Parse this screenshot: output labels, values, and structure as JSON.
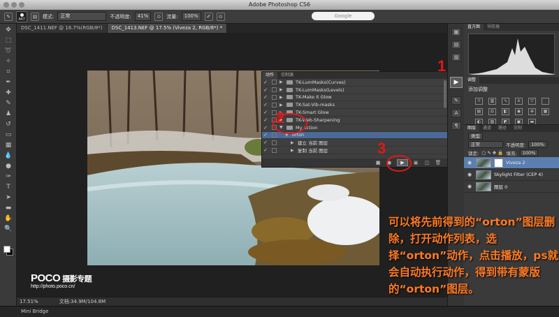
{
  "window": {
    "title": "Adobe Photoshop CS6",
    "watermark_top": "思缘设计论坛  PS教程论坛\nBBS.16XX8.COM"
  },
  "options_bar": {
    "brush_size": "447",
    "mode_label": "模式:",
    "mode_value": "正常",
    "opacity_label": "不透明度:",
    "opacity_value": "41%",
    "flow_label": "流量:",
    "flow_value": "100%",
    "search_placeholder": "Google",
    "workspace_watermark": "思缘设计论坛 PS教程论坛"
  },
  "doc_tabs": [
    {
      "label": "DSC_1411.NEF @ 16.7%(RGB/8*)"
    },
    {
      "label": "DSC_1413.NEF @ 17.5% (Viveza 2, RGB/8*) *"
    }
  ],
  "actions_panel": {
    "tabs": [
      "动作",
      "仿制源"
    ],
    "rows": [
      {
        "label": "TK-LumMasks(Curves)",
        "type": "set"
      },
      {
        "label": "TK-LumMasks(Levels)",
        "type": "set"
      },
      {
        "label": "TK-Make It Glow",
        "type": "set"
      },
      {
        "label": "TK-Sat-Vib-masks",
        "type": "set"
      },
      {
        "label": "TK-Smart Glow",
        "type": "set"
      },
      {
        "label": "TK-Web-Sharpening",
        "type": "set"
      },
      {
        "label": "My action",
        "type": "set"
      },
      {
        "label": "orton",
        "type": "action"
      },
      {
        "label": "建立 当前 图层",
        "type": "step"
      },
      {
        "label": "复制 当前 图层",
        "type": "step"
      }
    ]
  },
  "markers": [
    "1",
    "2",
    "3"
  ],
  "right_panel": {
    "histogram_tabs": [
      "直方图",
      "导航器"
    ],
    "adjust_tabs": [
      "调整"
    ],
    "adjust_title": "添加调整",
    "layers_tabs": [
      "图层",
      "通道",
      "路径",
      "仿制"
    ],
    "kind_label": "类型",
    "blend_mode": "正常",
    "opacity_label": "不透明度:",
    "opacity_value": "100%",
    "lock_label": "锁定:",
    "fill_label": "填充:",
    "fill_value": "100%",
    "layers": [
      {
        "name": "Viveza 2",
        "active": true
      },
      {
        "name": "Skylight Filter (CEP 4)",
        "active": false
      },
      {
        "name": "图层 0",
        "active": false
      }
    ]
  },
  "status": {
    "zoom": "17.51%",
    "doc": "文档:34.9M/104.8M"
  },
  "mini_bridge": "Mini Bridge",
  "caption": "可以将先前得到的“orton”图层删除，打开动作列表，选择“orton”动作，点击播放，ps就会自动执行动作，得到带有蒙版的“orton”图层。",
  "watermark": {
    "brand": "POCO",
    "sub": "摄影专题",
    "url": "http://photo.poco.cn/"
  }
}
